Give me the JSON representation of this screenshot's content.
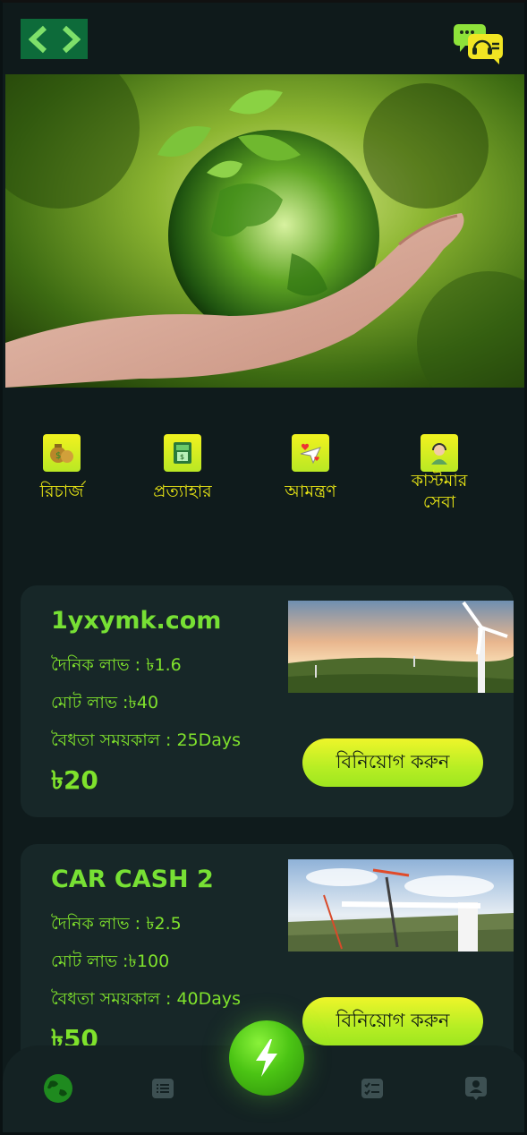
{
  "header": {
    "logo_icon": "code-brackets-logo",
    "support_icon": "chat-support-icon"
  },
  "banner": {
    "image": "hand-holding-green-earth-globe"
  },
  "actions": [
    {
      "label": "রিচার্জ",
      "icon": "money-bags-icon"
    },
    {
      "label": "প্রত্যাহার",
      "icon": "atm-withdraw-icon"
    },
    {
      "label": "আমন্ত্রণ",
      "icon": "invite-envelope-icon"
    },
    {
      "label": "কাস্টমার সেবা",
      "icon": "customer-service-icon"
    }
  ],
  "products": [
    {
      "name": "1yxymk.com",
      "daily": "দৈনিক লাভ : ৳1.6",
      "total": "মোট লাভ :৳40",
      "validity": "বৈধতা সময়কাল : 25Days",
      "price": "৳20",
      "button": "বিনিয়োগ করুন",
      "image": "wind-turbine-sunset"
    },
    {
      "name": "CAR CASH 2",
      "daily": "দৈনিক লাভ : ৳2.5",
      "total": "মোট লাভ :৳100",
      "validity": "বৈধতা সময়কাল : 40Days",
      "price": "৳50",
      "button": "বিনিয়োগ করুন",
      "image": "wind-turbine-construction-crane"
    }
  ],
  "bottom_nav": {
    "items": [
      "globe-icon",
      "list-icon",
      "lightning-icon",
      "checklist-icon",
      "profile-icon"
    ],
    "active": "globe-icon"
  },
  "colors": {
    "accent_green": "#7ee02f",
    "label_yellow": "#e9e615",
    "bg": "#0f1b1c",
    "card": "#172728"
  }
}
